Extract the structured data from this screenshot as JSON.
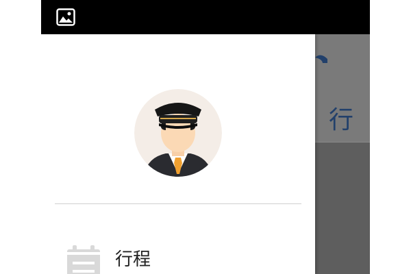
{
  "status_bar": {
    "background": "#000000",
    "icon": "gallery-icon"
  },
  "background_app": {
    "title": "行",
    "title_color": "#22406b"
  },
  "drawer": {
    "avatar_icon": "driver-avatar-icon",
    "menu": [
      {
        "label": "行程",
        "icon": "trip-list-icon"
      }
    ]
  }
}
